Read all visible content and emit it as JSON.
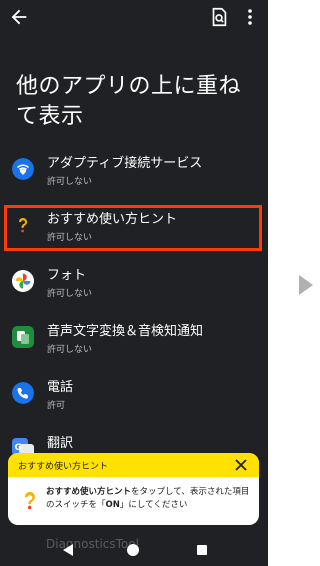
{
  "page": {
    "title_line1": "他のアプリの上に重ね",
    "title_line2": "て表示"
  },
  "apps": [
    {
      "name": "アダプティブ接続サービス",
      "status": "許可しない",
      "icon": "adaptive-connectivity-icon"
    },
    {
      "name": "おすすめ使い方ヒント",
      "status": "許可しない",
      "icon": "tips-icon"
    },
    {
      "name": "フォト",
      "status": "許可しない",
      "icon": "photos-icon"
    },
    {
      "name": "音声文字変換＆音検知通知",
      "status": "許可しない",
      "icon": "live-transcribe-icon"
    },
    {
      "name": "電話",
      "status": "許可",
      "icon": "phone-icon"
    },
    {
      "name": "翻訳",
      "status": "",
      "icon": "translate-icon"
    }
  ],
  "hidden_item": {
    "name": "DiagnosticsTool"
  },
  "toast": {
    "title": "おすすめ使い方ヒント",
    "bold_app": "おすすめ使い方ヒント",
    "text1": "をタップして、表示された項目のスイッチを「",
    "bold_on": "ON",
    "text2": "」にしてください"
  },
  "colors": {
    "background": "#202124",
    "highlight": "#ff3d00",
    "toast_header": "#ffe200"
  }
}
